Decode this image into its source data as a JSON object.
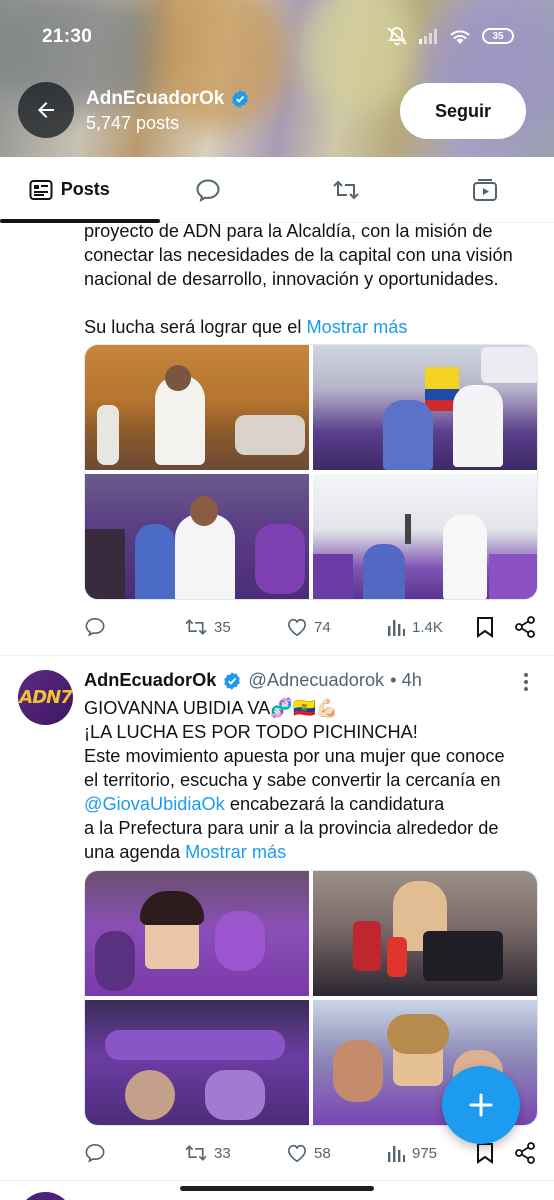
{
  "status_bar": {
    "time": "21:30",
    "battery": "35"
  },
  "header": {
    "name": "AdnEcuadorOk",
    "posts_count": "5,747 posts",
    "follow_label": "Seguir"
  },
  "tabs": [
    {
      "label": "Posts",
      "icon": "posts-icon"
    },
    {
      "icon": "replies-icon"
    },
    {
      "icon": "reposts-icon"
    },
    {
      "icon": "media-icon"
    }
  ],
  "post1": {
    "lines": [
      "proyecto de ADN para la Alcaldía, con la misión de",
      "conectar las necesidades de la capital con una visión",
      "nacional de desarrollo, innovación y oportunidades."
    ],
    "last_line": "Su lucha será lograr que el",
    "show_more": "Mostrar más",
    "stats": {
      "replies": "",
      "reposts": "35",
      "likes": "74",
      "views": "1.4K"
    }
  },
  "post2": {
    "avatar_text": "ADN7",
    "name": "AdnEcuadorOk",
    "handle": "@Adnecuadorok",
    "time": "• 4h",
    "title": "GIOVANNA UBIDIA VA🧬🇪🇨💪🏻",
    "lines": [
      "¡LA LUCHA ES POR TODO PICHINCHA!",
      "Este movimiento apuesta por una mujer que conoce",
      "el territorio, escucha y sabe convertir la cercanía en"
    ],
    "mention": "@GiovaUbidiaOk",
    "mention_after": "encabezará la candidatura",
    "line_after": "a la Prefectura para unir a la provincia alrededor de",
    "last_line": "una agenda",
    "show_more": "Mostrar más",
    "stats": {
      "replies": "",
      "reposts": "33",
      "likes": "58",
      "views": "975"
    }
  },
  "colors": {
    "accent": "#1d9bf0",
    "text": "#0f1419",
    "muted": "#536471",
    "avatar": "#4a2277"
  }
}
